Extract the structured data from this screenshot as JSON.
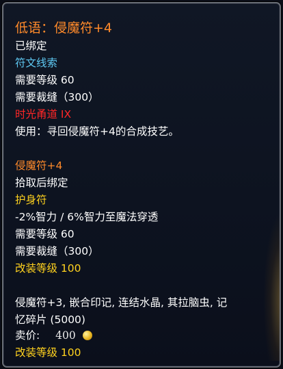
{
  "item_name": "低语：侵魔符+4",
  "binding": "已绑定",
  "category": "符文线索",
  "required_level": "需要等级 60",
  "required_tailoring": "需要裁缝（300）",
  "dungeon": "时光甬道 IX",
  "use_text": "使用：寻回侵魔符+4的合成技艺。",
  "recipe": {
    "name": "侵魔符+4",
    "binding": "拾取后绑定",
    "slot": "护身符",
    "stat": "-2%智力 / 6%智力至魔法穿透",
    "required_level": "需要等级 60",
    "required_tailoring": "需要裁缝（300）",
    "upgrade_level": "改装等级 100"
  },
  "reagents_line1": "侵魔符+3, 嵌合印记, 连结水晶, 其拉脑虫, 记",
  "reagents_line2": "忆碎片 (5000)",
  "sell_price_label": "卖价:",
  "sell_price_value": "400",
  "upgrade_level": "改装等级 100",
  "colors": {
    "name": "#ff8a2a",
    "category": "#5ec8f2",
    "dungeon": "#ff2626",
    "upgrade": "#ffd21e"
  },
  "icons": {
    "currency": "gold-coin-icon"
  }
}
